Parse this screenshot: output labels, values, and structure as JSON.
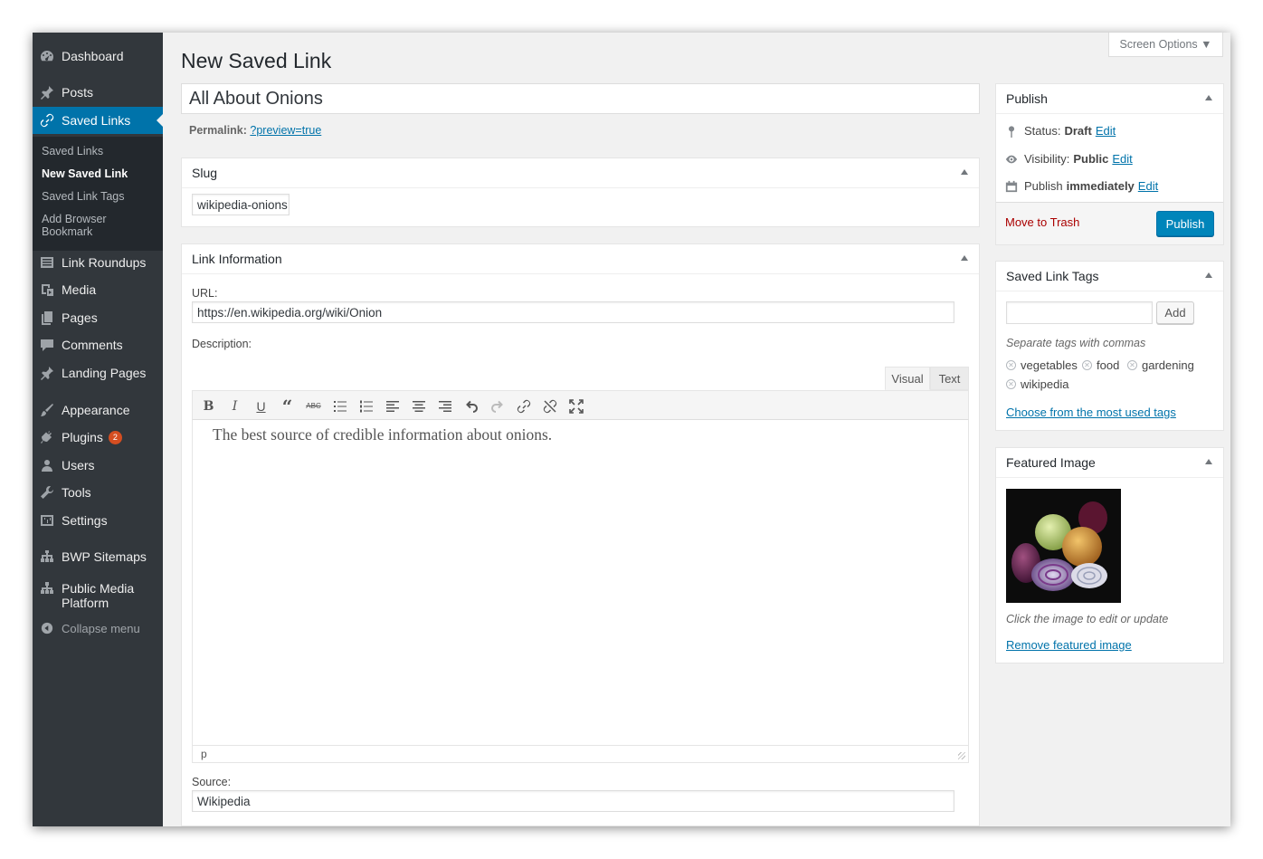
{
  "screen_options": "Screen Options ▼",
  "page_title": "New Saved Link",
  "post_title": "All About Onions",
  "permalink": {
    "label": "Permalink:",
    "link": "?preview=true"
  },
  "sidebar": {
    "items": [
      {
        "label": "Dashboard",
        "icon": "dashboard-icon"
      },
      {
        "label": "Posts",
        "icon": "pin-icon"
      },
      {
        "label": "Saved Links",
        "icon": "link-icon"
      },
      {
        "label": "Link Roundups",
        "icon": "list-icon"
      },
      {
        "label": "Media",
        "icon": "media-icon"
      },
      {
        "label": "Pages",
        "icon": "pages-icon"
      },
      {
        "label": "Comments",
        "icon": "comments-icon"
      },
      {
        "label": "Landing Pages",
        "icon": "pin-icon"
      },
      {
        "label": "Appearance",
        "icon": "paintbrush-icon"
      },
      {
        "label": "Plugins",
        "icon": "plugin-icon",
        "badge": "2"
      },
      {
        "label": "Users",
        "icon": "users-icon"
      },
      {
        "label": "Tools",
        "icon": "wrench-icon"
      },
      {
        "label": "Settings",
        "icon": "settings-icon"
      },
      {
        "label": "BWP Sitemaps",
        "icon": "sitemap-icon"
      },
      {
        "label": "Public Media Platform",
        "icon": "network-icon"
      }
    ],
    "submenu": [
      "Saved Links",
      "New Saved Link",
      "Saved Link Tags",
      "Add Browser Bookmark"
    ],
    "collapse": "Collapse menu"
  },
  "slug_box": {
    "title": "Slug",
    "value": "wikipedia-onions"
  },
  "link_info": {
    "title": "Link Information",
    "url_label": "URL:",
    "url_value": "https://en.wikipedia.org/wiki/Onion",
    "description_label": "Description:",
    "tabs": [
      "Visual",
      "Text"
    ],
    "editor_text": "The best source of credible information about onions.",
    "status_path": "p",
    "source_label": "Source:",
    "source_value": "Wikipedia"
  },
  "publish_box": {
    "title": "Publish",
    "status_label": "Status:",
    "status_value": "Draft",
    "visibility_label": "Visibility:",
    "visibility_value": "Public",
    "publish_label": "Publish",
    "publish_value": "immediately",
    "edit": "Edit",
    "trash": "Move to Trash",
    "publish_button": "Publish"
  },
  "tags_box": {
    "title": "Saved Link Tags",
    "add_button": "Add",
    "hint": "Separate tags with commas",
    "tags": [
      "vegetables",
      "food",
      "gardening",
      "wikipedia"
    ],
    "choose_link": "Choose from the most used tags"
  },
  "featured_box": {
    "title": "Featured Image",
    "hint": "Click the image to edit or update",
    "remove_link": "Remove featured image"
  },
  "colors": {
    "accent": "#0073aa",
    "sidebar": "#32373c",
    "button": "#0085ba",
    "trash": "#aa0000"
  }
}
